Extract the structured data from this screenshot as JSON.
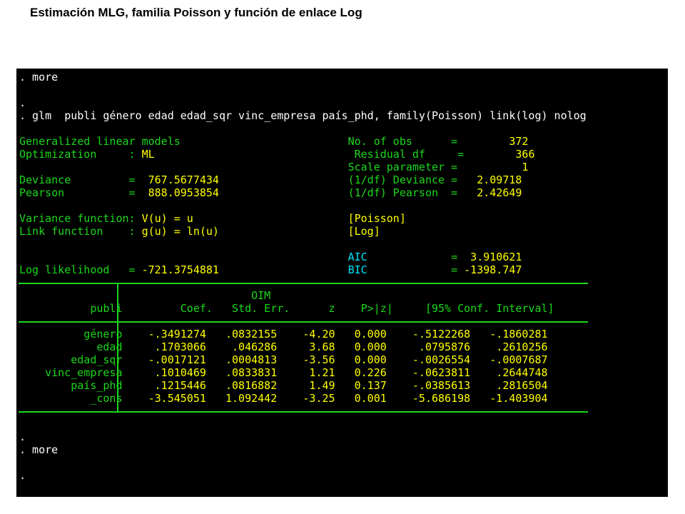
{
  "slide_title": "Estimación MLG, familia Poisson y función de enlace Log",
  "console": {
    "lines": [
      {
        "text": ". more",
        "color": "w"
      },
      {
        "text": "",
        "color": "w"
      },
      {
        "text": ".",
        "color": "w"
      },
      {
        "text": ". glm  publi género edad edad_sqr vinc_empresa país_phd, family(Poisson) link(log) nolog",
        "color": "w"
      },
      {
        "text": "",
        "color": "w"
      },
      {
        "segments": [
          {
            "text": "Generalized linear models                          ",
            "color": "g"
          },
          {
            "text": "No. of obs",
            "color": "g"
          },
          {
            "text": "      =        ",
            "color": "g"
          },
          {
            "text": "372",
            "color": "y"
          }
        ]
      },
      {
        "segments": [
          {
            "text": "Optimization     : ",
            "color": "g"
          },
          {
            "text": "ML",
            "color": "y"
          },
          {
            "text": "                               Residual df     =        ",
            "color": "g"
          },
          {
            "text": "366",
            "color": "y"
          }
        ]
      },
      {
        "segments": [
          {
            "text": "                                                   Scale parameter =          ",
            "color": "g"
          },
          {
            "text": "1",
            "color": "y"
          }
        ]
      },
      {
        "segments": [
          {
            "text": "Deviance         =  ",
            "color": "g"
          },
          {
            "text": "767.5677434",
            "color": "y"
          },
          {
            "text": "                    (1/df) Deviance =   ",
            "color": "g"
          },
          {
            "text": "2.09718",
            "color": "y"
          }
        ]
      },
      {
        "segments": [
          {
            "text": "Pearson          =  ",
            "color": "g"
          },
          {
            "text": "888.0953854",
            "color": "y"
          },
          {
            "text": "                    (1/df) Pearson  =   ",
            "color": "g"
          },
          {
            "text": "2.42649",
            "color": "y"
          }
        ]
      },
      {
        "text": "",
        "color": "g"
      },
      {
        "segments": [
          {
            "text": "Variance function: ",
            "color": "g"
          },
          {
            "text": "V(u) = u",
            "color": "y"
          },
          {
            "text": "                        ",
            "color": "g"
          },
          {
            "text": "[Poisson]",
            "color": "y"
          }
        ]
      },
      {
        "segments": [
          {
            "text": "Link function    : ",
            "color": "g"
          },
          {
            "text": "g(u) = ln(u)",
            "color": "y"
          },
          {
            "text": "                    ",
            "color": "g"
          },
          {
            "text": "[Log]",
            "color": "y"
          }
        ]
      },
      {
        "text": "",
        "color": "g"
      },
      {
        "segments": [
          {
            "text": "                                                   ",
            "color": "g"
          },
          {
            "text": "AIC",
            "color": "c"
          },
          {
            "text": "             =  ",
            "color": "g"
          },
          {
            "text": "3.910621",
            "color": "y"
          }
        ]
      },
      {
        "segments": [
          {
            "text": "Log likelihood   = ",
            "color": "g"
          },
          {
            "text": "-721.3754881",
            "color": "y"
          },
          {
            "text": "                    ",
            "color": "g"
          },
          {
            "text": "BIC",
            "color": "c"
          },
          {
            "text": "             = ",
            "color": "g"
          },
          {
            "text": "-1398.747",
            "color": "y"
          }
        ]
      }
    ],
    "table_header_1": "                                    OIM",
    "table_header_2": "           publi         Coef.   Std. Err.      z    P>|z|     [95% Conf. Interval]",
    "table_rows": [
      {
        "label": "          género",
        "values": "  -.3491274   .0832155    -4.20   0.000    -.5122268   -.1860281"
      },
      {
        "label": "            edad",
        "values": "   .1703066    .046286     3.68   0.000     .0795876    .2610256"
      },
      {
        "label": "        edad_sqr",
        "values": "  -.0017121   .0004813    -3.56   0.000    -.0026554   -.0007687"
      },
      {
        "label": "    vinc_empresa",
        "values": "   .1010469   .0833831     1.21   0.226    -.0623811    .2644748"
      },
      {
        "label": "        país_phd",
        "values": "   .1215446   .0816882     1.49   0.137    -.0385613    .2816504"
      },
      {
        "label": "           _cons",
        "values": "  -3.545051   1.092442    -3.25   0.001    -5.686198   -1.403904"
      }
    ],
    "footer_lines": [
      ".",
      ". more",
      "",
      "."
    ]
  }
}
